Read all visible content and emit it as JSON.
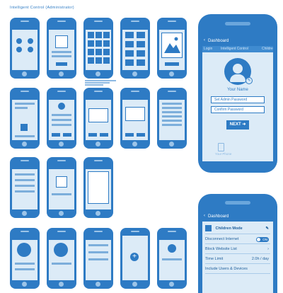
{
  "title": "Intelligent Control (Administrator)",
  "colors": {
    "accent": "#2e7bc4",
    "screen": "#dcebf7",
    "background": "#ffffff"
  },
  "signup_screen": {
    "header_title": "Dashboard",
    "tabs": [
      "Login",
      "Intelligent Control",
      "Childre"
    ],
    "avatar_icon": "user-avatar-icon",
    "name_label": "Your Name",
    "password_placeholder": "Set Admin Password",
    "confirm_placeholder": "Confirm Password",
    "next_label": "NEXT",
    "footer_label": "Your Phone"
  },
  "dashboard_screen": {
    "header_title": "Dashboard",
    "children_mode_label": "Children Mode",
    "disconnect_label": "Disconnect Internet",
    "toggle_label": "ON",
    "block_list_label": "Block Website List",
    "time_limit_label": "Time Limit",
    "time_limit_value": "2.0h / day",
    "include_label": "Include Users & Devices"
  }
}
